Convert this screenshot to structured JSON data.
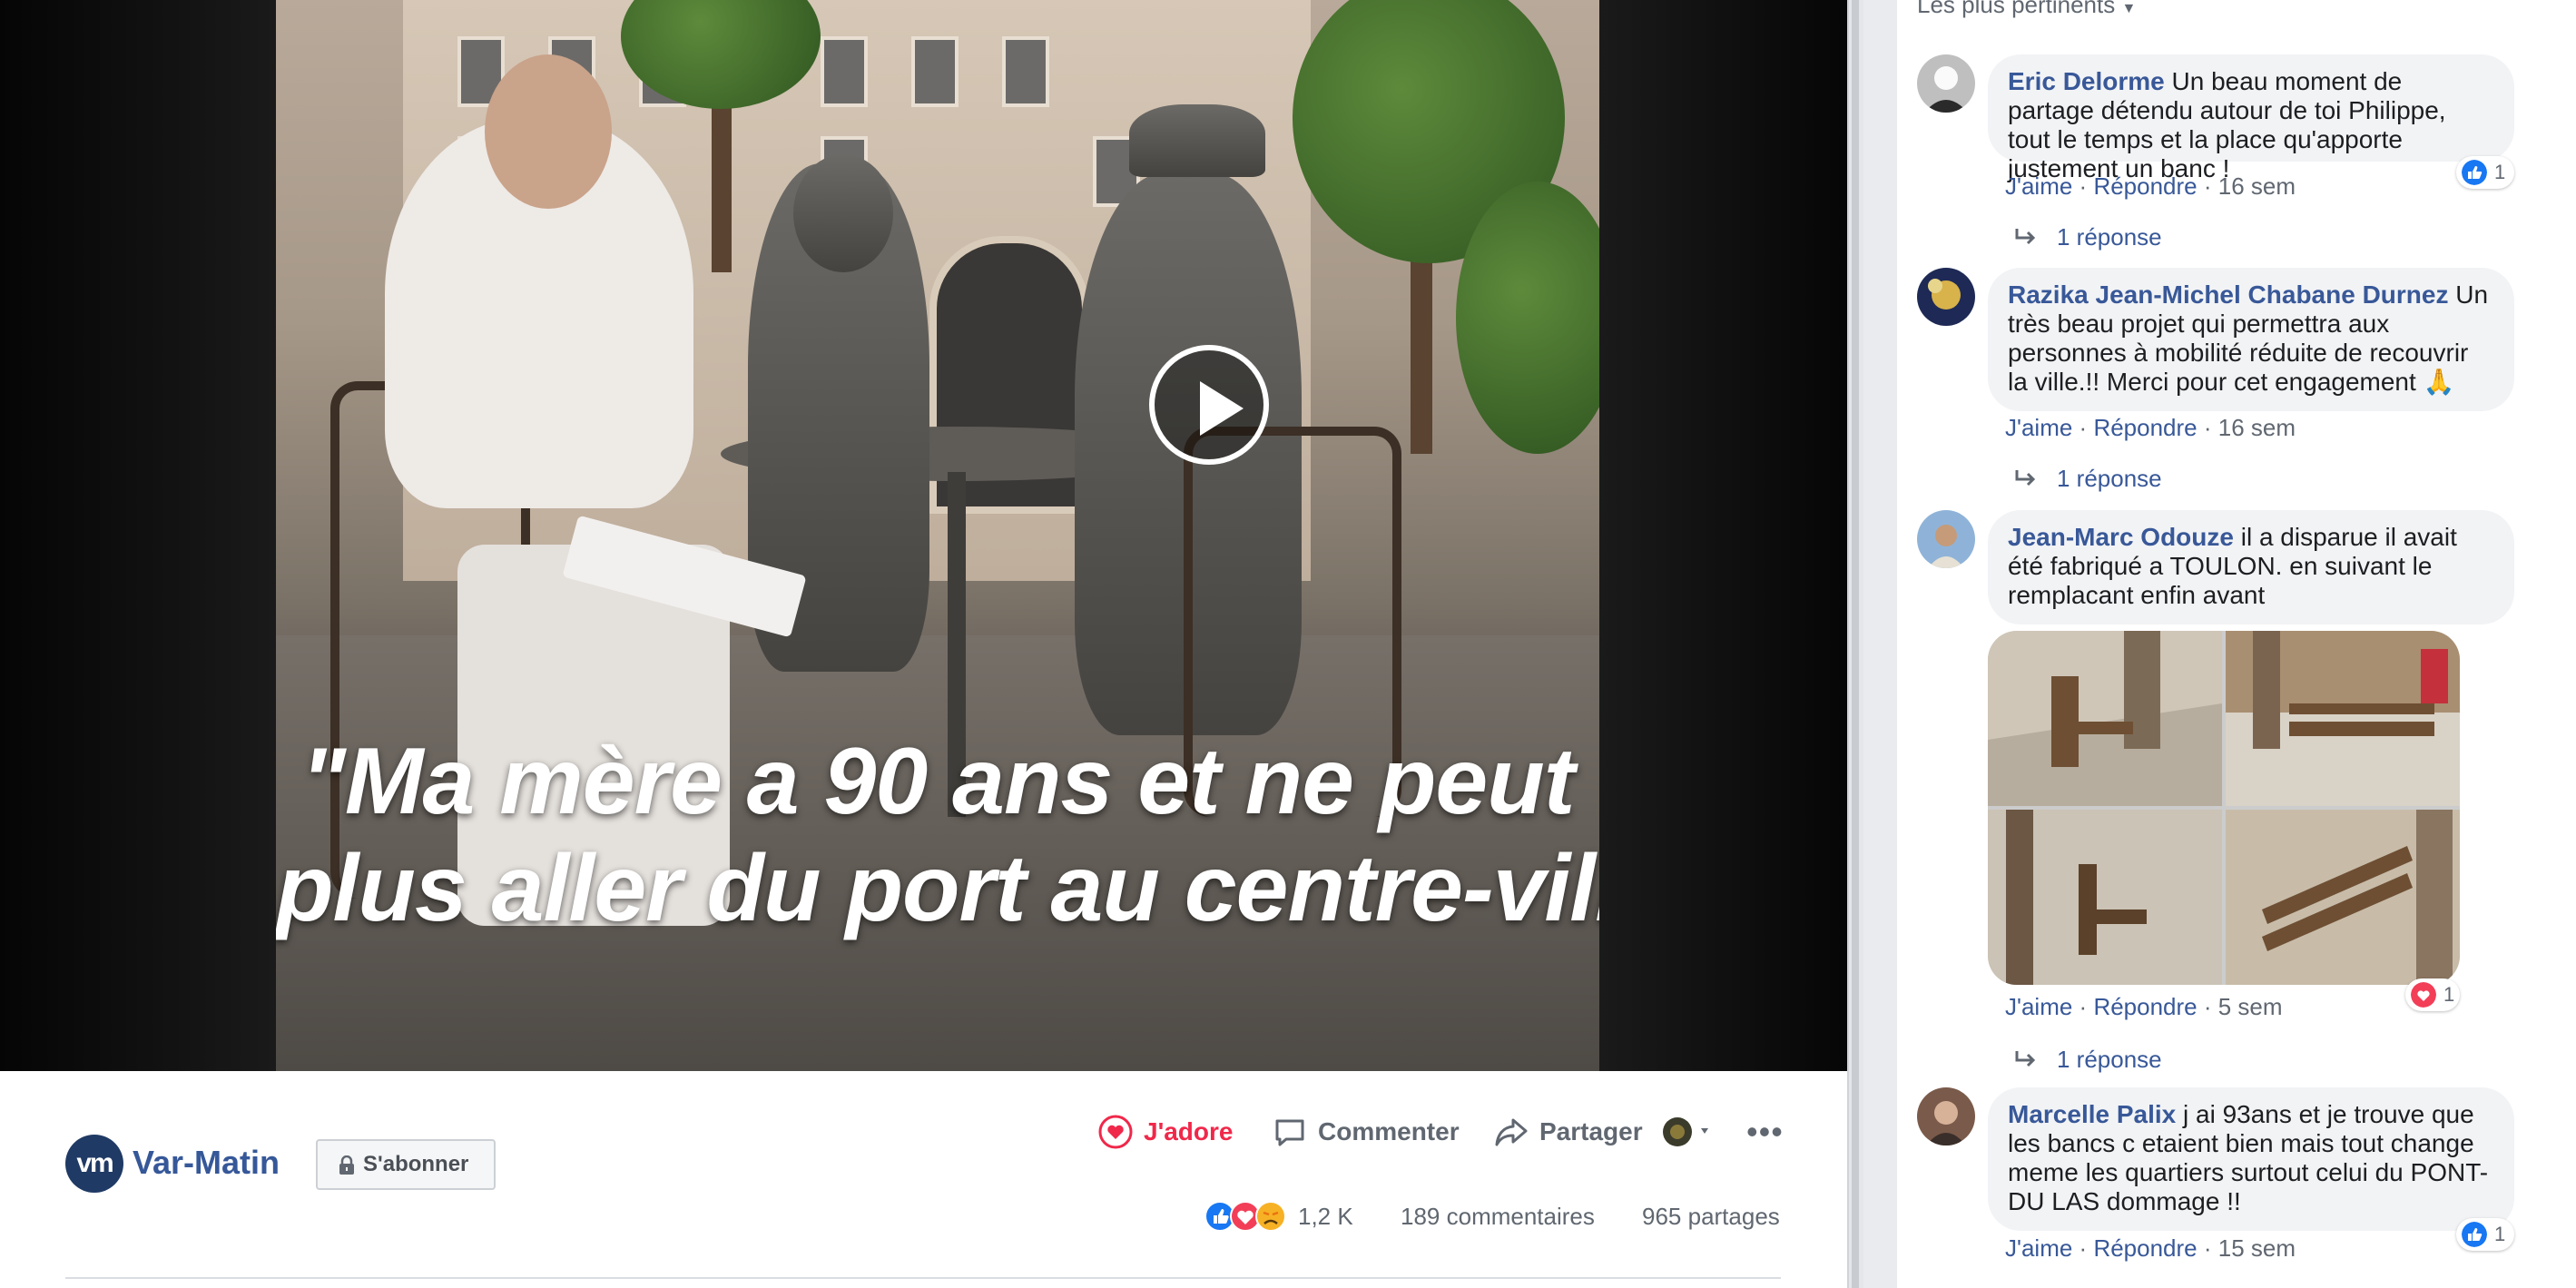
{
  "video": {
    "caption_line1": "\"Ma mère a 90 ans et ne peut",
    "caption_line2": "plus aller du port au centre-ville"
  },
  "post": {
    "page_name": "Var-Matin",
    "page_logo_text": "vm",
    "subscribe_label": "S'abonner",
    "actions": {
      "adore": "J'adore",
      "comment": "Commenter",
      "share": "Partager"
    },
    "stats": {
      "reactions": "1,2 K",
      "comments": "189 commentaires",
      "shares": "965 partages"
    },
    "colors": {
      "adore": "#f0284a",
      "link": "#385898",
      "brand": "#1f3a64"
    }
  },
  "comments_panel": {
    "sort_label": "Les plus pertinents",
    "comments": [
      {
        "author": "Eric Delorme",
        "text": "Un beau moment de partage détendu autour de toi Philippe, tout le temps et la place qu'apporte justement un banc !",
        "like": "J'aime",
        "reply": "Répondre",
        "time": "16 sem",
        "reaction_count": "1",
        "reaction_icon": "like-icon",
        "replies": "1 réponse"
      },
      {
        "author": "Razika Jean-Michel Chabane Durnez",
        "text": "Un très beau projet qui permettra aux personnes à mobilité réduite de recouvrir la ville.!! Merci pour cet engagement 🙏",
        "like": "J'aime",
        "reply": "Répondre",
        "time": "16 sem",
        "replies": "1 réponse"
      },
      {
        "author": "Jean-Marc Odouze",
        "text": "il a disparue il avait été fabriqué a TOULON. en suivant le remplacant enfin avant",
        "like": "J'aime",
        "reply": "Répondre",
        "time": "5 sem",
        "reaction_count": "1",
        "reaction_icon": "love-icon",
        "replies": "1 réponse"
      },
      {
        "author": "Marcelle Palix",
        "text": "j ai 93ans et je trouve que les bancs c etaient bien mais tout change meme les quartiers surtout celui du PONT-DU LAS dommage !!",
        "like": "J'aime",
        "reply": "Répondre",
        "time": "15 sem",
        "reaction_count": "1",
        "reaction_icon": "like-icon"
      }
    ]
  }
}
